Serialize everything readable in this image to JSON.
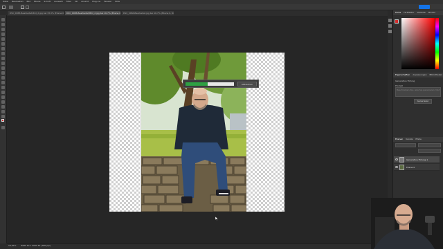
{
  "app": {
    "accent": "#2ea043"
  },
  "menu": {
    "items": [
      "Datei",
      "Bearbeiten",
      "Bild",
      "Ebene",
      "Schrift",
      "Auswahl",
      "Filter",
      "3D",
      "Ansicht",
      "Plug-ins",
      "Fenster",
      "Hilfe"
    ]
  },
  "tabs": [
    {
      "label": "DSC_0065-Bearbeitet-Bild_2.jpg bei 33,3% (Ebene 0, RGB/8) *",
      "active": false
    },
    {
      "label": "DSC_0065-Bearbeitet-Bild_2.jpg bei 16,7% (Ebene 0, RGB/8) *",
      "active": true
    },
    {
      "label": "DSC_0066-Bearbeitet.jpg bei 16,7% (Ebene 0, RGB/8)",
      "active": false
    }
  ],
  "progress": {
    "value": 0.45,
    "cancel_label": "Abbrechen"
  },
  "status": {
    "zoom": "16,67%",
    "doc_size": "6000 Px x 4000 Px (300 ppi)"
  },
  "panels": {
    "color_tabs": [
      "Farbe",
      "Farbfelder",
      "Verläufe",
      "Muster"
    ],
    "properties_tabs": [
      "Eigenschaften",
      "Anpassungen",
      "Bibliotheken"
    ],
    "properties": {
      "title": "Generative Füllung",
      "prompt_label": "Prompt",
      "prompt_placeholder": "Beschreiben Sie, was Sie generieren möchten",
      "generate_label": "Generieren"
    },
    "layers_tabs": [
      "Ebenen",
      "Kanäle",
      "Pfade"
    ],
    "layers": [
      {
        "name": "Generative Füllung 1",
        "selected": true
      },
      {
        "name": "Ebene 0",
        "selected": false
      }
    ]
  },
  "colors": {
    "foreground": "#d42b2b",
    "background": "#ffffff"
  }
}
